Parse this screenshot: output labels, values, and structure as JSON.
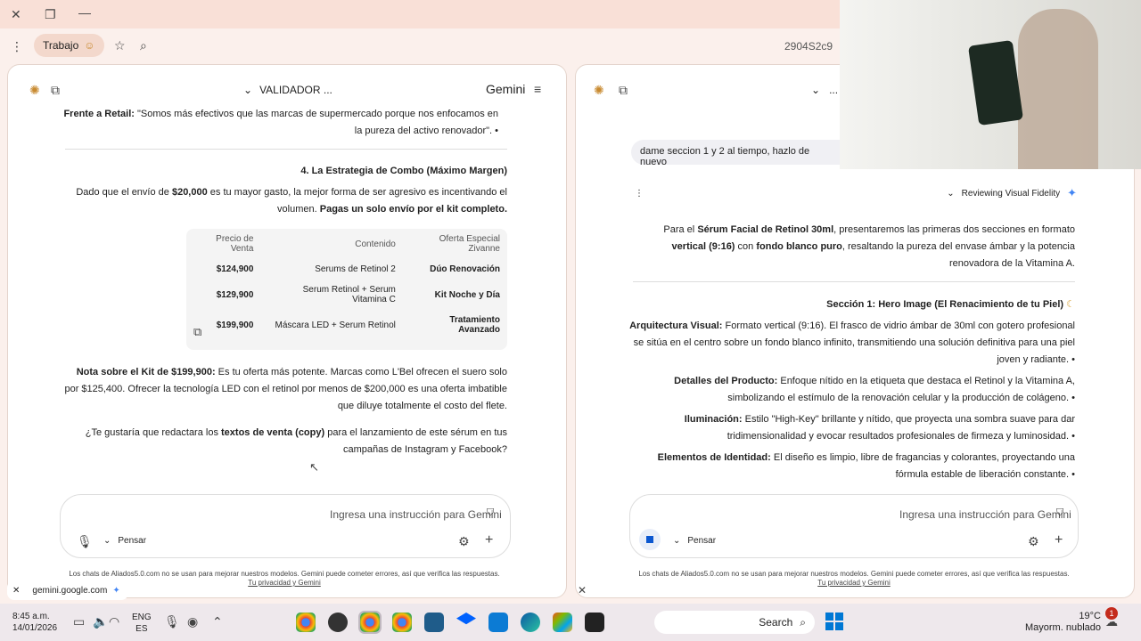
{
  "browser": {
    "tab_title": "gemini.google.com",
    "url_fragment": "2904S2c9",
    "profile_label": "Trabajo"
  },
  "left_pane": {
    "header_title": "Gemini",
    "menu_label": "VALIDADOR ...",
    "intro_bullet_title": "Frente a Retail:",
    "intro_bullet_text": "\"Somos más efectivos que las marcas de supermercado porque nos enfocamos en la pureza del activo renovador\".",
    "section_title": "4. La Estrategia de Combo (Máximo Margen)",
    "section_p1_a": "Dado que el envío de ",
    "section_p1_b": "$20,000",
    "section_p1_c": " es tu mayor gasto, la mejor forma de ser agresivo es incentivando el volumen. ",
    "section_p1_d": "Pagas un solo envío por el kit completo.",
    "table_headers": [
      "Oferta Especial Zivanne",
      "Contenido",
      "Precio de Venta"
    ],
    "table_rows": [
      [
        "Dúo Renovación",
        "2 Serums de Retinol",
        "$124,900"
      ],
      [
        "Kit Noche y Día",
        "Serum Retinol + Serum Vitamina C",
        "$129,900"
      ],
      [
        "Tratamiento Avanzado",
        "Máscara LED + Serum Retinol",
        "$199,900"
      ]
    ],
    "note_title": "Nota sobre el Kit de $199,900:",
    "note_text": " Es tu oferta más potente. Marcas como L'Bel ofrecen el suero solo por $125,400. Ofrecer la tecnología LED con el retinol por menos de $200,000 es una oferta imbatible que diluye totalmente el costo del flete.",
    "question_a": "¿Te gustaría que redactara los ",
    "question_b": "textos de venta (copy)",
    "question_c": " para el lanzamiento de este sérum en tus campañas de Instagram y Facebook?",
    "input_placeholder": "Ingresa una instrucción para Gemini",
    "mode_label": "Pensar",
    "footer": "Los chats de Aliados5.0.com no se usan para mejorar nuestros modelos. Gemini puede cometer errores, así que verifica las respuestas.",
    "footer_link": "Tu privacidad y Gemini"
  },
  "right_pane": {
    "menu_label": "...",
    "user_msg": "dame seccion 1 y 2 al tiempo, hazlo de nuevo",
    "status_label": "Reviewing Visual Fidelity",
    "p1_a": "Para el ",
    "p1_b": "Sérum Facial de Retinol 30ml",
    "p1_c": ", presentaremos las primeras dos secciones en formato ",
    "p1_d": "vertical (9:16)",
    "p1_e": " con ",
    "p1_f": "fondo blanco puro",
    "p1_g": ", resaltando la pureza del envase ámbar y la potencia renovadora de la Vitamina A.",
    "section1_title": "Sección 1: Hero Image (El Renacimiento de tu Piel)",
    "bullets": [
      {
        "t": "Arquitectura Visual:",
        "d": " Formato vertical (9:16). El frasco de vidrio ámbar de 30ml con gotero profesional se sitúa en el centro sobre un fondo blanco infinito, transmitiendo una solución definitiva para una piel joven y radiante."
      },
      {
        "t": "Detalles del Producto:",
        "d": " Enfoque nítido en la etiqueta que destaca el Retinol y la Vitamina A, simbolizando el estímulo de la renovación celular y la producción de colágeno."
      },
      {
        "t": "Iluminación:",
        "d": " Estilo \"High-Key\" brillante y nítido, que proyecta una sombra suave para dar tridimensionalidad y evocar resultados profesionales de firmeza y luminosidad."
      },
      {
        "t": "Elementos de Identidad:",
        "d": " El diseño es limpio, libre de fragancias y colorantes, proyectando una fórmula estable de liberación constante."
      }
    ],
    "input_placeholder": "Ingresa una instrucción para Gemini",
    "mode_label": "Pensar",
    "footer": "Los chats de Aliados5.0.com no se usan para mejorar nuestros modelos. Gemini puede cometer errores, así que verifica las respuestas.",
    "footer_link": "Tu privacidad y Gemini"
  },
  "taskbar": {
    "time": "8:45 a.m.",
    "date": "14/01/2026",
    "lang1": "ENG",
    "lang2": "ES",
    "search": "Search",
    "temp": "19°C",
    "weather": "Mayorm. nublado",
    "badge": "1"
  },
  "colors": {
    "accent": "#0b57d0",
    "chrome": "#f9e0d7",
    "taskbar": "#eee8ec"
  }
}
